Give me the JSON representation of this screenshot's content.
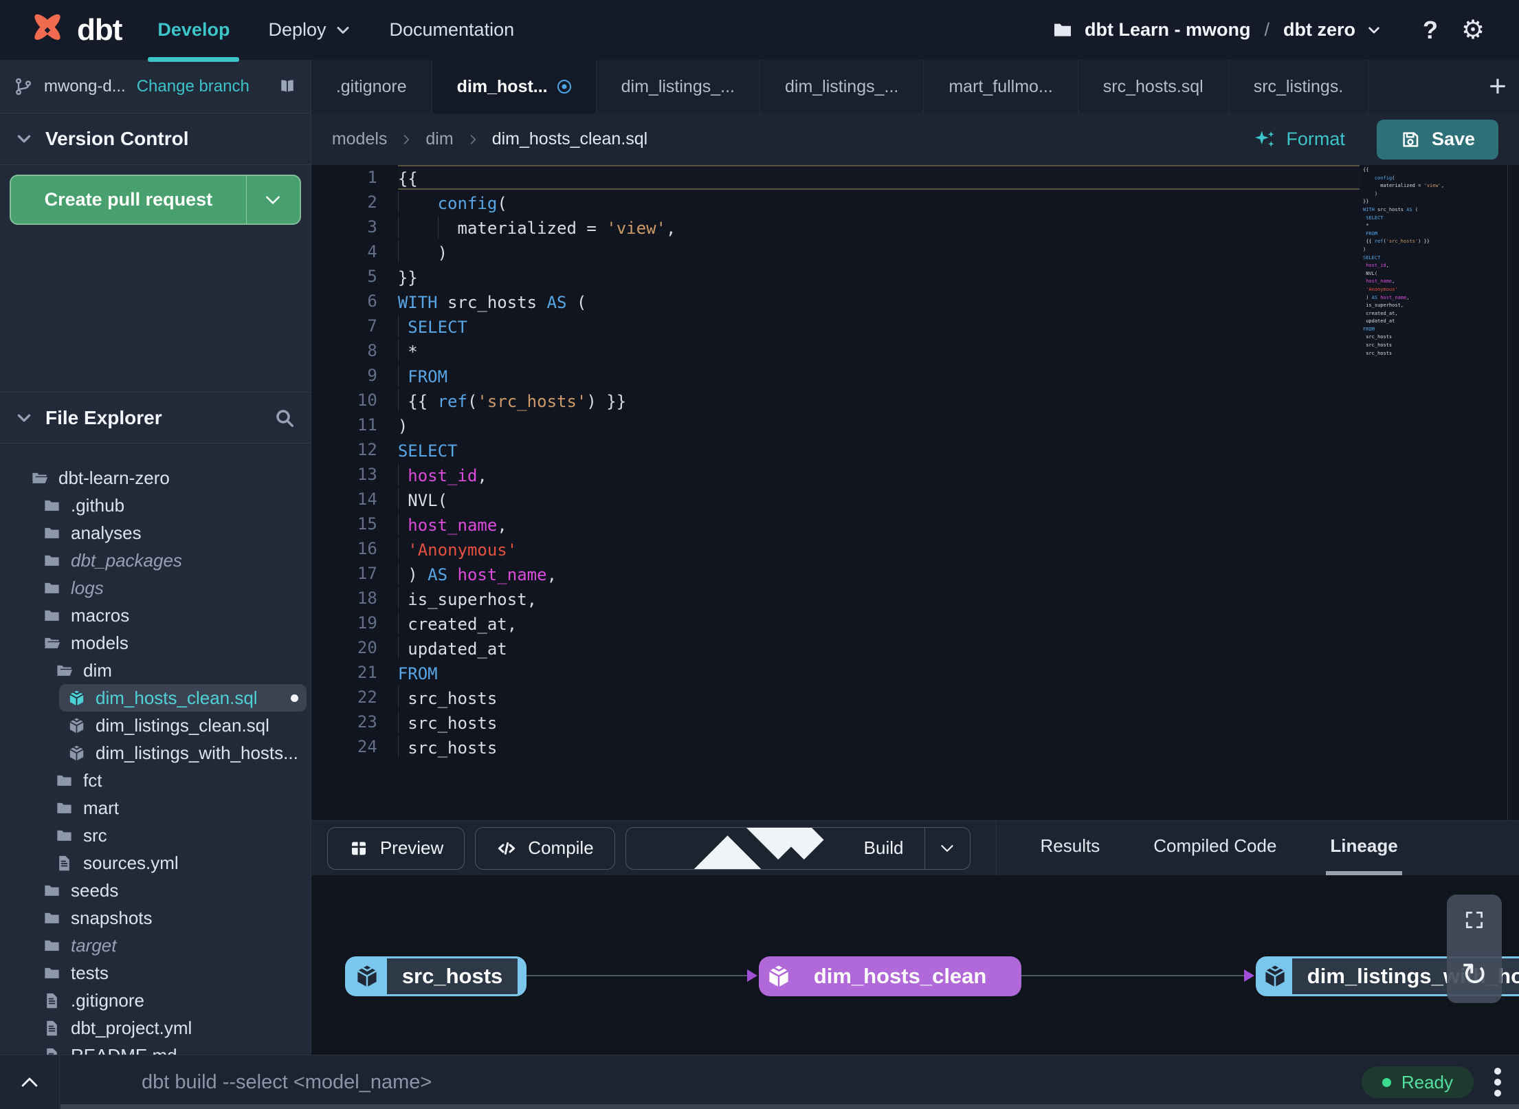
{
  "colors": {
    "accent_teal": "#3cc4c9",
    "logo_orange": "#f06a50",
    "button_green": "#47a06d",
    "save_teal": "#2e7077",
    "node_purple": "#b168d9",
    "node_blue": "#7ac6ec",
    "ready_green": "#3bdc90",
    "modified_blue": "#4da6e8"
  },
  "nav": {
    "brand": "dbt",
    "items": [
      {
        "label": "Develop",
        "active": true
      },
      {
        "label": "Deploy",
        "chevron": true
      },
      {
        "label": "Documentation"
      }
    ],
    "project": {
      "account": "dbt Learn - mwong",
      "separator": "/",
      "environment": "dbt zero"
    },
    "help_label": "?"
  },
  "sidebar": {
    "branch": {
      "name": "mwong-d...",
      "action": "Change branch"
    },
    "version_control": {
      "title": "Version Control",
      "create_pr_label": "Create pull request"
    },
    "file_explorer": {
      "title": "File Explorer"
    },
    "tree": [
      {
        "label": "dbt-learn-zero",
        "icon": "folder-open",
        "level": 0
      },
      {
        "label": ".github",
        "icon": "folder",
        "level": 1
      },
      {
        "label": "analyses",
        "icon": "folder",
        "level": 1
      },
      {
        "label": "dbt_packages",
        "icon": "folder",
        "level": 1,
        "italic": true
      },
      {
        "label": "logs",
        "icon": "folder",
        "level": 1,
        "italic": true
      },
      {
        "label": "macros",
        "icon": "folder",
        "level": 1
      },
      {
        "label": "models",
        "icon": "folder-open",
        "level": 1
      },
      {
        "label": "dim",
        "icon": "folder-open",
        "level": 2
      },
      {
        "label": "dim_hosts_clean.sql",
        "icon": "model",
        "level": 3,
        "selected": true,
        "modified": true
      },
      {
        "label": "dim_listings_clean.sql",
        "icon": "model",
        "level": 3
      },
      {
        "label": "dim_listings_with_hosts...",
        "icon": "model",
        "level": 3
      },
      {
        "label": "fct",
        "icon": "folder",
        "level": 2
      },
      {
        "label": "mart",
        "icon": "folder",
        "level": 2
      },
      {
        "label": "src",
        "icon": "folder",
        "level": 2
      },
      {
        "label": "sources.yml",
        "icon": "file",
        "level": 2
      },
      {
        "label": "seeds",
        "icon": "folder",
        "level": 1
      },
      {
        "label": "snapshots",
        "icon": "folder",
        "level": 1
      },
      {
        "label": "target",
        "icon": "folder",
        "level": 1,
        "italic": true
      },
      {
        "label": "tests",
        "icon": "folder",
        "level": 1
      },
      {
        "label": ".gitignore",
        "icon": "file",
        "level": 1
      },
      {
        "label": "dbt_project.yml",
        "icon": "file",
        "level": 1
      },
      {
        "label": "README.md",
        "icon": "file",
        "level": 1
      }
    ]
  },
  "tabs": {
    "items": [
      {
        "label": ".gitignore"
      },
      {
        "label": "dim_host...",
        "active": true,
        "modified": true
      },
      {
        "label": "dim_listings_..."
      },
      {
        "label": "dim_listings_..."
      },
      {
        "label": "mart_fullmo..."
      },
      {
        "label": "src_hosts.sql"
      },
      {
        "label": "src_listings."
      }
    ],
    "add_label": "+"
  },
  "editor": {
    "breadcrumb": [
      "models",
      "dim",
      "dim_hosts_clean.sql"
    ],
    "format_label": "Format",
    "save_label": "Save",
    "lines": [
      {
        "n": 1,
        "current": true,
        "guides": [],
        "tokens": [
          [
            "{{",
            "p"
          ]
        ]
      },
      {
        "n": 2,
        "guides": [
          0
        ],
        "tokens": [
          [
            "    ",
            "p"
          ],
          [
            "config",
            "b"
          ],
          [
            "(",
            "p"
          ]
        ]
      },
      {
        "n": 3,
        "guides": [
          0,
          4
        ],
        "tokens": [
          [
            "      ",
            "p"
          ],
          [
            "materialized = ",
            "p"
          ],
          [
            "'view'",
            "o"
          ],
          [
            ",",
            "p"
          ]
        ]
      },
      {
        "n": 4,
        "guides": [
          0
        ],
        "tokens": [
          [
            "    )",
            "p"
          ]
        ]
      },
      {
        "n": 5,
        "guides": [],
        "tokens": [
          [
            "}}",
            "p"
          ]
        ]
      },
      {
        "n": 6,
        "guides": [],
        "tokens": [
          [
            "WITH",
            "b"
          ],
          [
            " src_hosts ",
            "p"
          ],
          [
            "AS",
            "b"
          ],
          [
            " (",
            "p"
          ]
        ]
      },
      {
        "n": 7,
        "guides": [
          0
        ],
        "tokens": [
          [
            " ",
            "p"
          ],
          [
            "SELECT",
            "b"
          ]
        ]
      },
      {
        "n": 8,
        "guides": [
          0
        ],
        "tokens": [
          [
            " *",
            "p"
          ]
        ]
      },
      {
        "n": 9,
        "guides": [
          0
        ],
        "tokens": [
          [
            " ",
            "p"
          ],
          [
            "FROM",
            "b"
          ]
        ]
      },
      {
        "n": 10,
        "guides": [
          0
        ],
        "tokens": [
          [
            " {{ ",
            "p"
          ],
          [
            "ref",
            "b"
          ],
          [
            "(",
            "p"
          ],
          [
            "'src_hosts'",
            "o"
          ],
          [
            ") }}",
            "p"
          ]
        ]
      },
      {
        "n": 11,
        "guides": [],
        "tokens": [
          [
            ")",
            "p"
          ]
        ]
      },
      {
        "n": 12,
        "guides": [],
        "tokens": [
          [
            "SELECT",
            "b"
          ]
        ]
      },
      {
        "n": 13,
        "guides": [
          0
        ],
        "tokens": [
          [
            " ",
            "p"
          ],
          [
            "host_id",
            "m"
          ],
          [
            ",",
            "p"
          ]
        ]
      },
      {
        "n": 14,
        "guides": [
          0
        ],
        "tokens": [
          [
            " NVL(",
            "p"
          ]
        ]
      },
      {
        "n": 15,
        "guides": [
          0
        ],
        "tokens": [
          [
            " ",
            "p"
          ],
          [
            "host_name",
            "m"
          ],
          [
            ",",
            "p"
          ]
        ]
      },
      {
        "n": 16,
        "guides": [
          0
        ],
        "tokens": [
          [
            " ",
            "p"
          ],
          [
            "'Anonymous'",
            "r"
          ]
        ]
      },
      {
        "n": 17,
        "guides": [
          0
        ],
        "tokens": [
          [
            " ) ",
            "p"
          ],
          [
            "AS",
            "b"
          ],
          [
            " ",
            "p"
          ],
          [
            "host_name",
            "m"
          ],
          [
            ",",
            "p"
          ]
        ]
      },
      {
        "n": 18,
        "guides": [
          0
        ],
        "tokens": [
          [
            " is_superhost,",
            "p"
          ]
        ]
      },
      {
        "n": 19,
        "guides": [
          0
        ],
        "tokens": [
          [
            " created_at,",
            "p"
          ]
        ]
      },
      {
        "n": 20,
        "guides": [
          0
        ],
        "tokens": [
          [
            " updated_at",
            "p"
          ]
        ]
      },
      {
        "n": 21,
        "guides": [],
        "tokens": [
          [
            "FROM",
            "b"
          ]
        ]
      },
      {
        "n": 22,
        "guides": [
          0
        ],
        "tokens": [
          [
            " src_hosts",
            "p"
          ]
        ]
      },
      {
        "n": 23,
        "guides": [
          0
        ],
        "tokens": [
          [
            " src_hosts",
            "p"
          ]
        ]
      },
      {
        "n": 24,
        "guides": [
          0
        ],
        "tokens": [
          [
            " src_hosts",
            "p"
          ]
        ]
      }
    ]
  },
  "actions": {
    "preview": "Preview",
    "compile": "Compile",
    "build": "Build"
  },
  "result_tabs": [
    {
      "label": "Results"
    },
    {
      "label": "Compiled Code"
    },
    {
      "label": "Lineage",
      "active": true
    }
  ],
  "lineage": {
    "nodes": [
      {
        "label": "src_hosts",
        "type": "source"
      },
      {
        "label": "dim_hosts_clean",
        "type": "model"
      },
      {
        "label": "dim_listings_with_hosts",
        "type": "source"
      }
    ]
  },
  "command_bar": {
    "placeholder": "dbt build --select <model_name>",
    "status": "Ready"
  }
}
